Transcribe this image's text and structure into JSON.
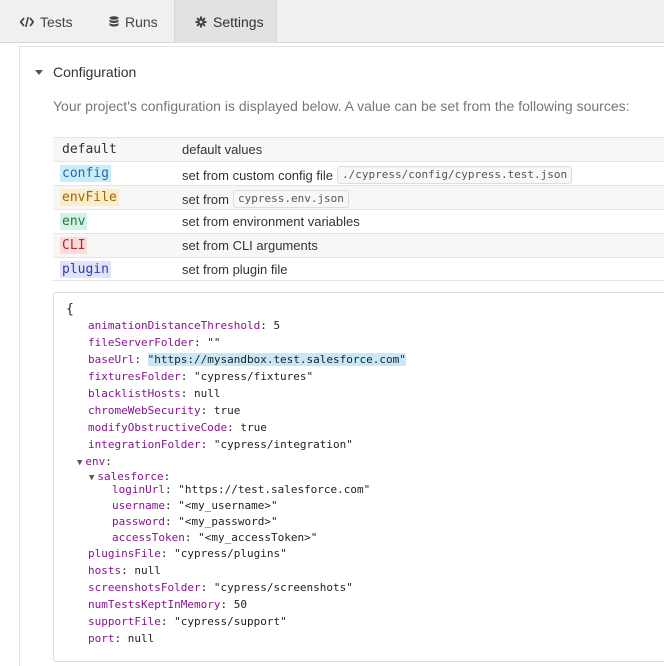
{
  "tabs": [
    {
      "label": "Tests",
      "icon": "code-icon",
      "active": false
    },
    {
      "label": "Runs",
      "icon": "database-icon",
      "active": false
    },
    {
      "label": "Settings",
      "icon": "gear-icon",
      "active": true
    }
  ],
  "section": {
    "title": "Configuration",
    "intro": "Your project's configuration is displayed below. A value can be set from the following sources:"
  },
  "sources": [
    {
      "key": "default",
      "desc": "default values",
      "code": "",
      "color": "#333333",
      "bg": "transparent"
    },
    {
      "key": "config",
      "desc": "set from custom config file",
      "code": "./cypress/config/cypress.test.json",
      "color": "#1e6aa8",
      "bg": "#c9ecf9"
    },
    {
      "key": "envFile",
      "desc": "set from",
      "code": "cypress.env.json",
      "color": "#9a6a00",
      "bg": "#fbeccc"
    },
    {
      "key": "env",
      "desc": "set from environment variables",
      "code": "",
      "color": "#1d7a49",
      "bg": "#d4f3e4"
    },
    {
      "key": "CLI",
      "desc": "set from CLI arguments",
      "code": "",
      "color": "#b02a2a",
      "bg": "#fbdada"
    },
    {
      "key": "plugin",
      "desc": "set from plugin file",
      "code": "",
      "color": "#2b3fa0",
      "bg": "#e2e3fb"
    }
  ],
  "config": {
    "open_brace": "{",
    "lines": [
      {
        "key": "animationDistanceThreshold",
        "value": "5"
      },
      {
        "key": "fileServerFolder",
        "value": "\"\""
      },
      {
        "key": "baseUrl",
        "value": "\"https://mysandbox.test.salesforce.com\"",
        "highlight": true
      },
      {
        "key": "fixturesFolder",
        "value": "\"cypress/fixtures\""
      },
      {
        "key": "blacklistHosts",
        "value": "null"
      },
      {
        "key": "chromeWebSecurity",
        "value": "true"
      },
      {
        "key": "modifyObstructiveCode",
        "value": "true"
      },
      {
        "key": "integrationFolder",
        "value": "\"cypress/integration\""
      },
      {
        "key": "env",
        "value": "",
        "expandable": true
      },
      {
        "key": "salesforce",
        "value": "",
        "expandable": true
      },
      {
        "key": "loginUrl",
        "value": "\"https://test.salesforce.com\""
      },
      {
        "key": "username",
        "value": "\"<my_username>\""
      },
      {
        "key": "password",
        "value": "\"<my_password>\""
      },
      {
        "key": "accessToken",
        "value": "\"<my_accessToken>\""
      },
      {
        "key": "pluginsFile",
        "value": "\"cypress/plugins\""
      },
      {
        "key": "hosts",
        "value": "null"
      },
      {
        "key": "screenshotsFolder",
        "value": "\"cypress/screenshots\""
      },
      {
        "key": "numTestsKeptInMemory",
        "value": "50"
      },
      {
        "key": "supportFile",
        "value": "\"cypress/support\""
      },
      {
        "key": "port",
        "value": "null"
      }
    ]
  }
}
